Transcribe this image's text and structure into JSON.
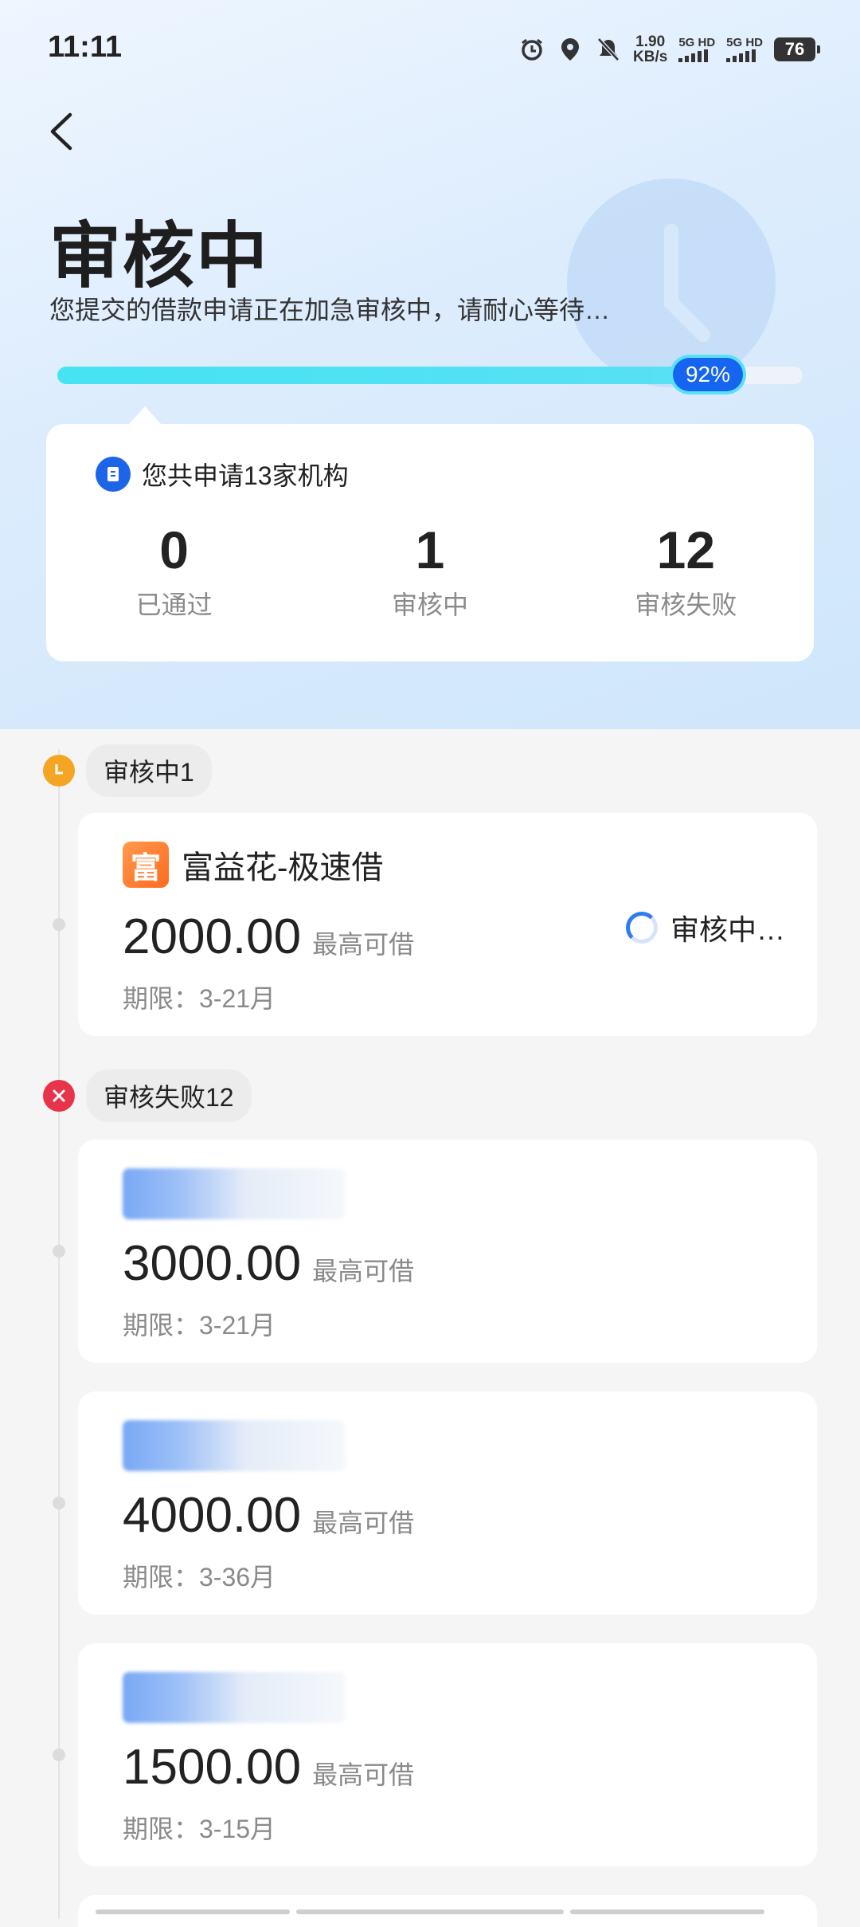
{
  "status_bar": {
    "time": "11:11",
    "net_speed": "1.90",
    "net_unit": "KB/s",
    "sim1": "5G HD",
    "sim2": "5G HD",
    "battery": "76",
    "icons": [
      "alarm-icon",
      "location-icon",
      "mute-icon"
    ]
  },
  "header": {
    "title": "审核中",
    "subtitle": "您提交的借款申请正在加急审核中，请耐心等待…",
    "progress_percent": 92,
    "progress_label": "92%"
  },
  "summary": {
    "heading": "您共申请13家机构",
    "stats": [
      {
        "value": "0",
        "label": "已通过"
      },
      {
        "value": "1",
        "label": "审核中"
      },
      {
        "value": "12",
        "label": "审核失败"
      }
    ]
  },
  "sections": {
    "reviewing": {
      "label": "审核中1",
      "dot_color": "#f5a524"
    },
    "failed": {
      "label": "审核失败12",
      "dot_color": "#e8344a"
    }
  },
  "reviewing_items": [
    {
      "logo_char": "富",
      "name": "富益花-极速借",
      "amount": "2000.00",
      "amount_label": "最高可借",
      "term": "期限：3-21月",
      "status": "审核中…"
    }
  ],
  "failed_items": [
    {
      "amount": "3000.00",
      "amount_label": "最高可借",
      "term": "期限：3-21月"
    },
    {
      "amount": "4000.00",
      "amount_label": "最高可借",
      "term": "期限：3-36月"
    },
    {
      "amount": "1500.00",
      "amount_label": "最高可借",
      "term": "期限：3-15月"
    }
  ],
  "colors": {
    "accent": "#1565f0",
    "progress": "#46e3f2"
  }
}
